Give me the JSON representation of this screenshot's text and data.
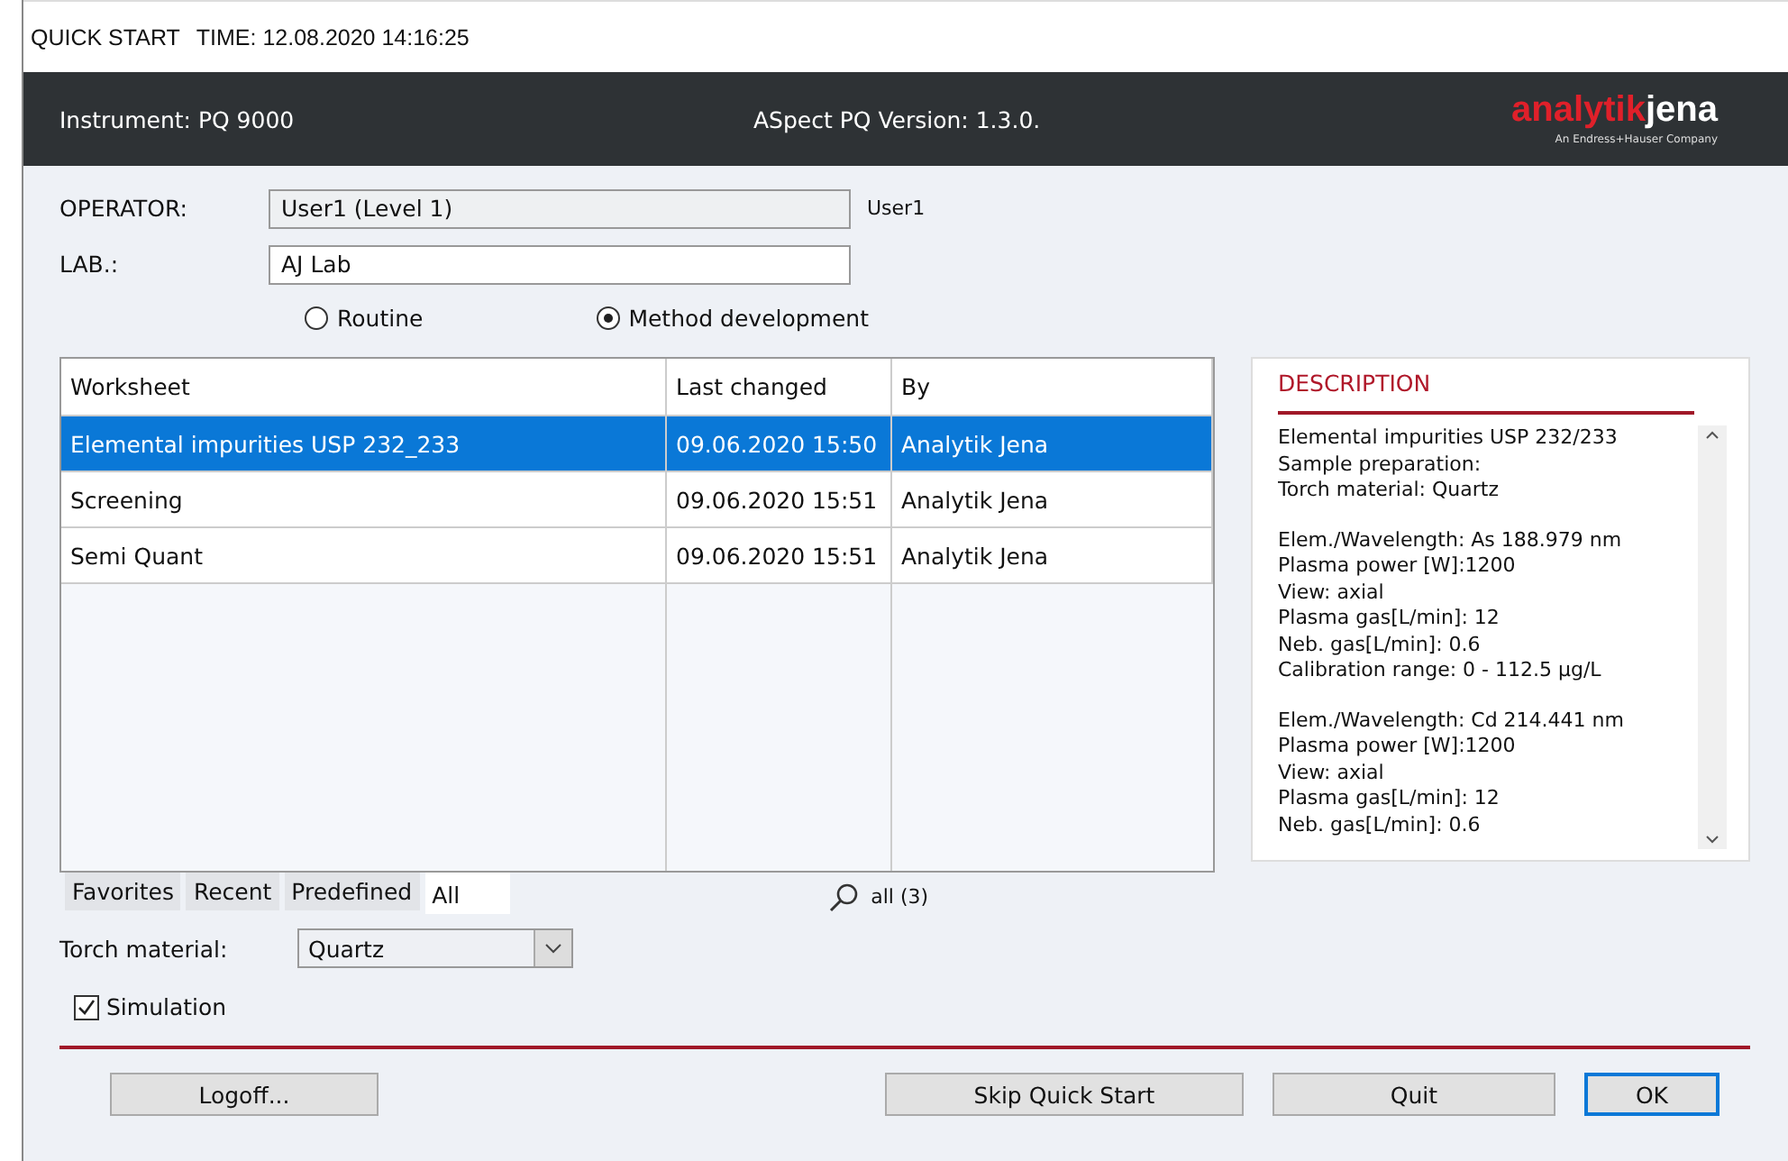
{
  "window": {
    "title": "QUICK START",
    "time": "TIME: 12.08.2020 14:16:25"
  },
  "header": {
    "instrument": "Instrument: PQ 9000",
    "version": "ASpect PQ Version: 1.3.0.",
    "logo_left": "analytik",
    "logo_right": "jena",
    "logo_tagline": "An Endress+Hauser Company"
  },
  "operator": {
    "label": "OPERATOR:",
    "value": "User1 (Level 1)",
    "user": "User1"
  },
  "lab": {
    "label": "LAB.:",
    "value": "AJ Lab"
  },
  "modes": [
    {
      "label": "Routine",
      "selected": false
    },
    {
      "label": "Method development",
      "selected": true
    }
  ],
  "table": {
    "columns": [
      "Worksheet",
      "Last changed",
      "By"
    ],
    "rows": [
      {
        "cells": [
          "Elemental impurities USP 232_233",
          "09.06.2020 15:50",
          "Analytik Jena"
        ],
        "selected": true
      },
      {
        "cells": [
          "Screening",
          "09.06.2020 15:51",
          "Analytik Jena"
        ],
        "selected": false
      },
      {
        "cells": [
          "Semi Quant",
          "09.06.2020 15:51",
          "Analytik Jena"
        ],
        "selected": false
      }
    ]
  },
  "filter_tabs": [
    {
      "label": "Favorites",
      "selected": false
    },
    {
      "label": "Recent",
      "selected": false
    },
    {
      "label": "Predefined",
      "selected": false
    },
    {
      "label": "All",
      "selected": true
    }
  ],
  "search": {
    "count": "all (3)"
  },
  "description": {
    "title": "DESCRIPTION",
    "paragraphs": [
      [
        "Elemental impurities USP 232/233",
        "Sample preparation:",
        "Torch material: Quartz"
      ],
      [
        "Elem./Wavelength: As 188.979 nm",
        "Plasma power [W]:1200",
        "View: axial",
        "Plasma gas[L/min]: 12",
        "Neb. gas[L/min]: 0.6",
        "Calibration range: 0 - 112.5 µg/L"
      ],
      [
        "Elem./Wavelength: Cd 214.441 nm",
        "Plasma power [W]:1200",
        "View: axial",
        "Plasma gas[L/min]: 12",
        "Neb. gas[L/min]: 0.6"
      ]
    ]
  },
  "torch": {
    "label": "Torch material:",
    "value": "Quartz"
  },
  "simulation": {
    "label": "Simulation",
    "checked": true
  },
  "buttons": [
    {
      "label": "Logoff...",
      "default": false
    },
    {
      "label": "Skip Quick Start",
      "default": false
    },
    {
      "label": "Quit",
      "default": false
    },
    {
      "label": "OK",
      "default": true
    }
  ]
}
